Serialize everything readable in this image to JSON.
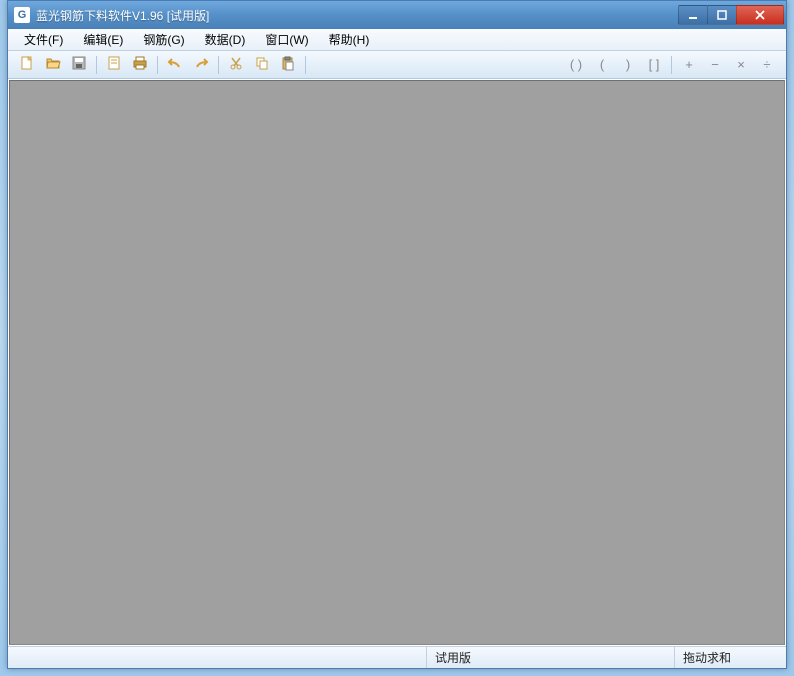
{
  "title": "蓝光钢筋下料软件V1.96 [试用版]",
  "menu": {
    "file": "文件(F)",
    "edit": "编辑(E)",
    "rebar": "钢筋(G)",
    "data": "数据(D)",
    "window": "窗口(W)",
    "help": "帮助(H)"
  },
  "symbols": {
    "paren1": "( )",
    "paren2": "(",
    "paren3": ")",
    "bracket": "[ ]",
    "plus": "+",
    "minus": "−",
    "times": "×",
    "divide": "÷"
  },
  "status": {
    "mid": "试用版",
    "right": "拖动求和"
  }
}
